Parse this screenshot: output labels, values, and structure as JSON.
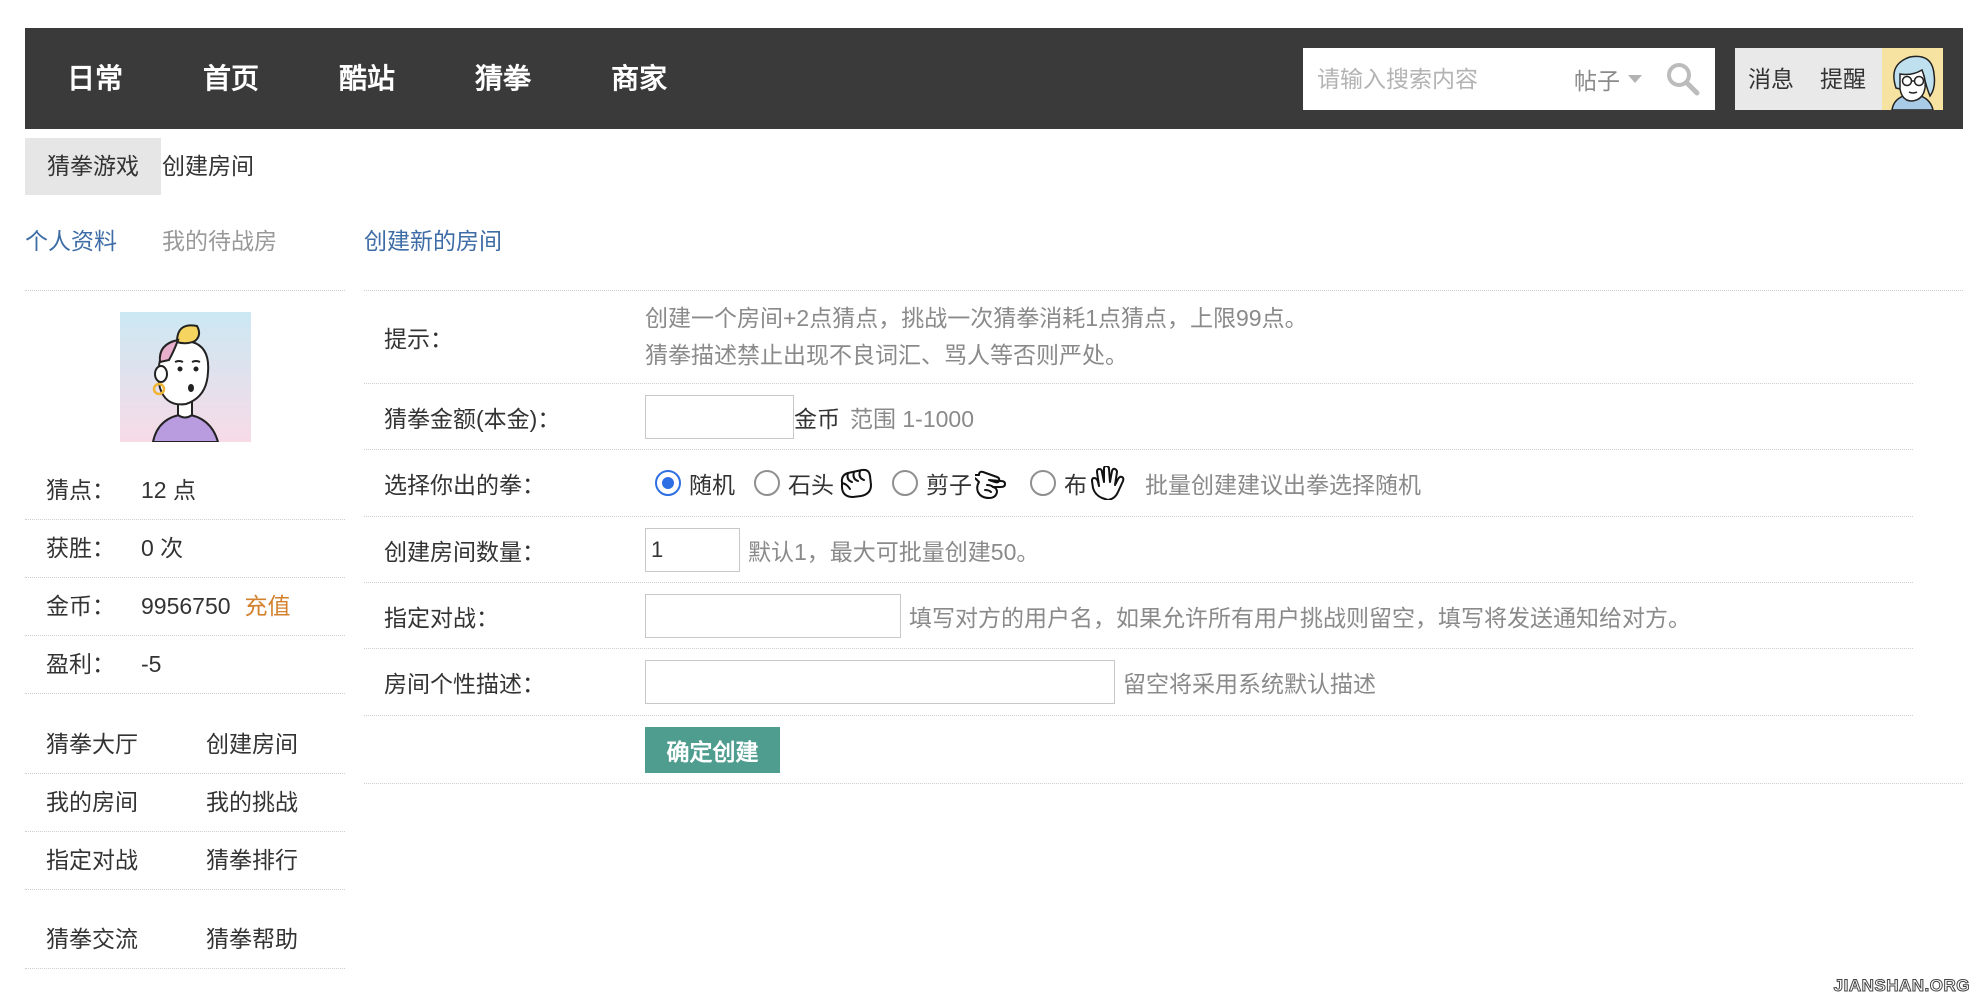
{
  "colors": {
    "nav_bg": "#3a3a3a",
    "link": "#3e6ca6",
    "recharge": "#d3812d",
    "button": "#4f9d8f",
    "radio": "#2e6fe3",
    "hint": "#8a8a8a"
  },
  "nav": {
    "items": [
      "日常",
      "首页",
      "酷站",
      "猜拳",
      "商家"
    ],
    "search": {
      "placeholder": "请输入搜索内容",
      "type": "帖子",
      "icon": "search-icon"
    },
    "messages": "消息",
    "reminders": "提醒"
  },
  "breadcrumb": {
    "section": "猜拳游戏",
    "current": "创建房间"
  },
  "tabs": {
    "profile": "个人资料",
    "waiting_rooms": "我的待战房",
    "create_room": "创建新的房间"
  },
  "profile": {
    "stats": [
      {
        "label": "猜点：",
        "value": "12 点"
      },
      {
        "label": "获胜：",
        "value": "0 次"
      },
      {
        "label": "金币：",
        "value": "9956750",
        "action": "充值"
      },
      {
        "label": "盈利：",
        "value": "-5"
      }
    ],
    "links": [
      [
        "猜拳大厅",
        "创建房间"
      ],
      [
        "我的房间",
        "我的挑战"
      ],
      [
        "指定对战",
        "猜拳排行"
      ],
      [
        "猜拳交流",
        "猜拳帮助"
      ]
    ]
  },
  "form": {
    "tip": {
      "label": "提示：",
      "lines": [
        "创建一个房间+2点猜点，挑战一次猜拳消耗1点猜点，上限99点。",
        "猜拳描述禁止出现不良词汇、骂人等否则严处。"
      ]
    },
    "amount": {
      "label": "猜拳金额(本金)：",
      "unit": "金币",
      "hint": "范围 1-1000"
    },
    "hand": {
      "label": "选择你出的拳：",
      "options": [
        {
          "label": "随机",
          "checked": true
        },
        {
          "label": "石头",
          "checked": false,
          "icon": "fist-icon"
        },
        {
          "label": "剪子",
          "checked": false,
          "icon": "scissors-hand-icon"
        },
        {
          "label": "布",
          "checked": false,
          "icon": "palm-icon"
        }
      ],
      "hint": "批量创建建议出拳选择随机"
    },
    "count": {
      "label": "创建房间数量：",
      "value": "1",
      "hint": "默认1，最大可批量创建50。"
    },
    "opponent": {
      "label": "指定对战：",
      "hint": "填写对方的用户名，如果允许所有用户挑战则留空，填写将发送通知给对方。"
    },
    "description": {
      "label": "房间个性描述：",
      "hint": "留空将采用系统默认描述"
    },
    "submit": "确定创建"
  },
  "watermark": "JIANSHAN.ORG"
}
